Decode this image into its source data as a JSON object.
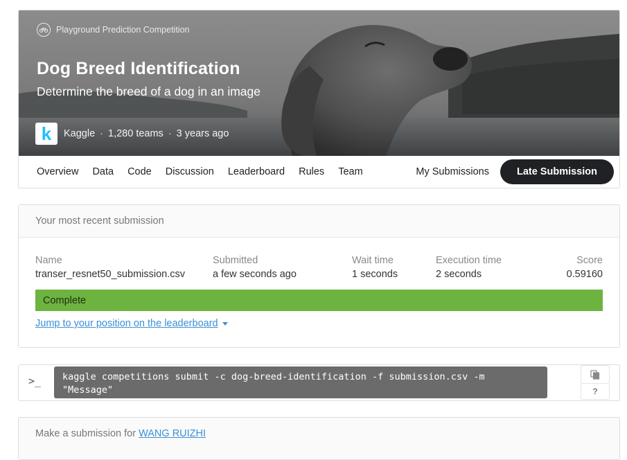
{
  "header": {
    "competition_type": "Playground Prediction Competition",
    "competition_type_icon": "bicycle-icon",
    "title": "Dog Breed Identification",
    "subtitle": "Determine the breed of a dog in an image",
    "host": "Kaggle",
    "host_logo_letter": "k",
    "teams": "1,280 teams",
    "time": "3 years ago",
    "separator": "·"
  },
  "nav": {
    "tabs": [
      "Overview",
      "Data",
      "Code",
      "Discussion",
      "Leaderboard",
      "Rules",
      "Team"
    ],
    "my_submissions": "My Submissions",
    "late_submission": "Late Submission"
  },
  "submission": {
    "heading": "Your most recent submission",
    "columns": {
      "name_label": "Name",
      "name_value": "transer_resnet50_submission.csv",
      "submitted_label": "Submitted",
      "submitted_value": "a few seconds ago",
      "wait_label": "Wait time",
      "wait_value": "1 seconds",
      "exec_label": "Execution time",
      "exec_value": "2 seconds",
      "score_label": "Score",
      "score_value": "0.59160"
    },
    "status": "Complete",
    "status_progress": 1.0,
    "status_color": "#6db33f",
    "jump_link": "Jump to your position on the leaderboard"
  },
  "api": {
    "prompt_icon": "terminal-icon",
    "prompt": ">_",
    "command": "kaggle competitions submit -c dog-breed-identification -f submission.csv -m \"Message\"",
    "copy_icon": "copy-icon",
    "help": "?"
  },
  "make_submission": {
    "text": "Make a submission for",
    "user": "WANG RUIZHI"
  },
  "colors": {
    "accent_link": "#3b8fd6",
    "late_button": "#202124",
    "kaggle_blue": "#20beff"
  }
}
